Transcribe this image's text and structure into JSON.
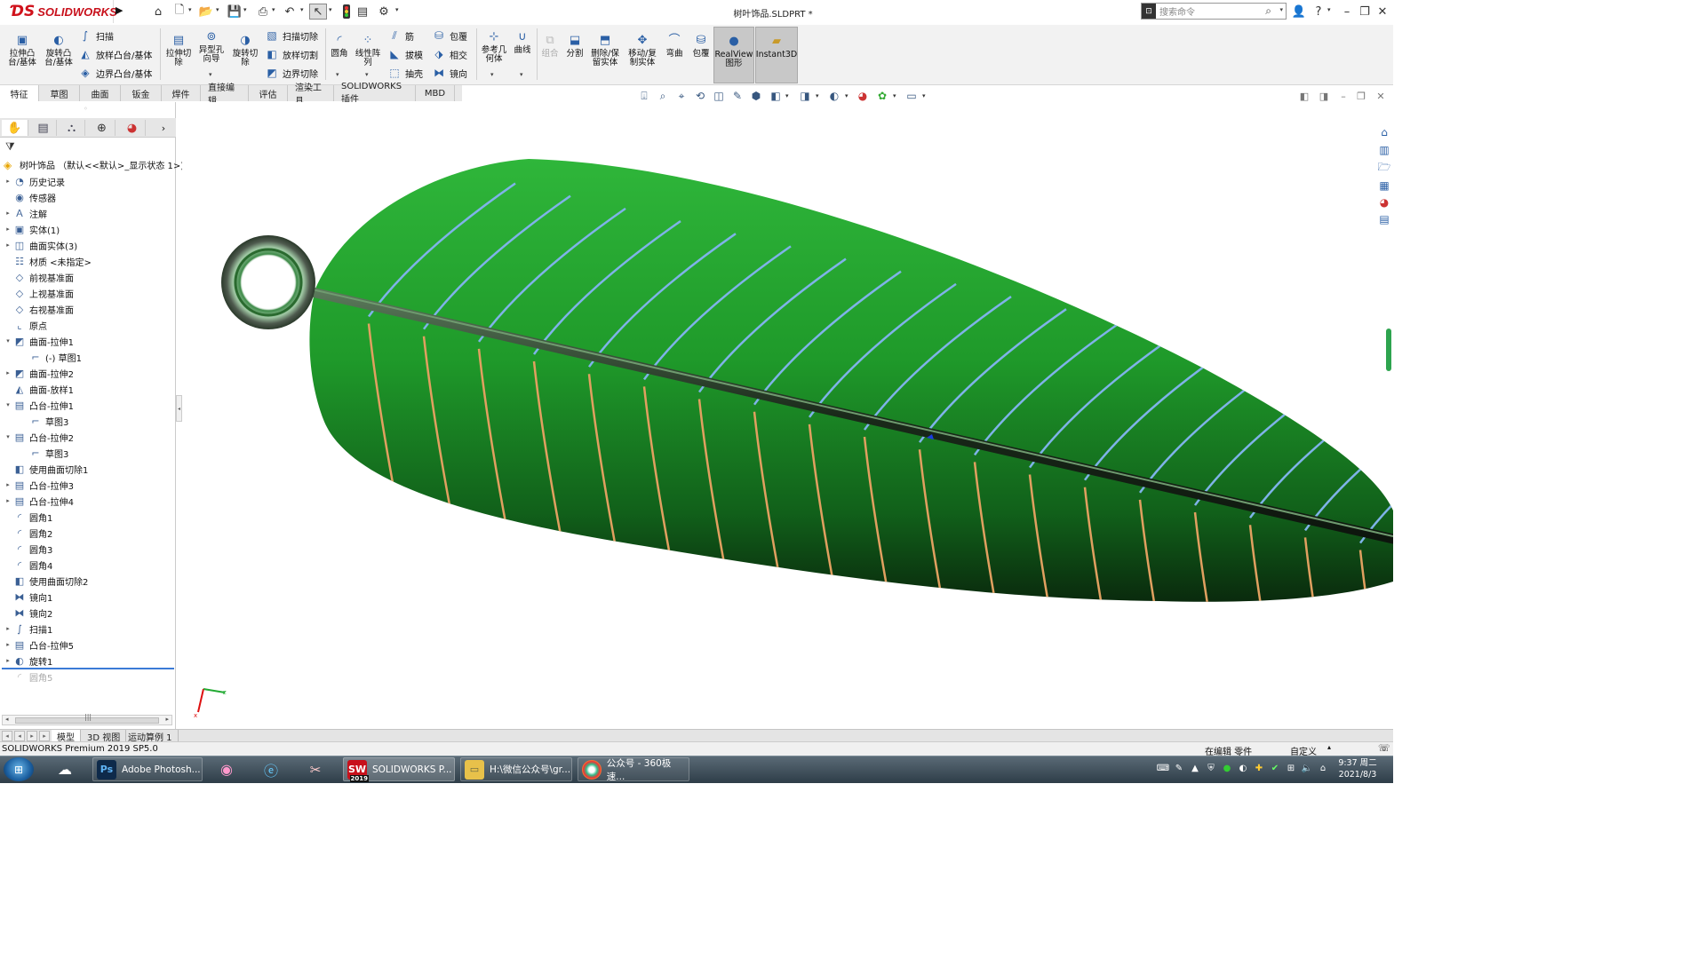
{
  "app": {
    "brand": "SOLIDWORKS",
    "doc_title": "树叶饰品.SLDPRT *"
  },
  "search": {
    "placeholder": "搜索命令"
  },
  "ribbon": {
    "big": {
      "extrude_boss": "拉伸凸\n台/基体",
      "revolve_boss": "旋转凸\n台/基体",
      "extrude_cut": "拉伸切\n除",
      "hole_wizard": "异型孔\n向导",
      "revolve_cut": "旋转切\n除",
      "fillet": "圆角",
      "linear_pattern": "线性阵\n列",
      "ref_geometry": "参考几\n何体",
      "curves": "曲线",
      "combine": "组合",
      "split": "分割",
      "delete_keep": "删除/保\n留实体",
      "move_copy": "移动/复\n制实体",
      "flex": "弯曲",
      "wrap2": "包覆",
      "realview": "RealView\n图形",
      "instant3d": "Instant3D"
    },
    "small": {
      "sweep": "扫描",
      "loft": "放样凸台/基体",
      "boundary": "边界凸台/基体",
      "sweep_cut": "扫描切除",
      "loft_cut": "放样切割",
      "boundary_cut": "边界切除",
      "rib": "筋",
      "draft": "拔模",
      "shell": "抽壳",
      "wrap": "包覆",
      "intersect": "相交",
      "mirror": "镜向"
    }
  },
  "tabs": [
    "特征",
    "草图",
    "曲面",
    "钣金",
    "焊件",
    "直接编辑",
    "评估",
    "渲染工具",
    "SOLIDWORKS 插件",
    "MBD"
  ],
  "tree": {
    "root": "树叶饰品 （默认<<默认>_显示状态 1>)",
    "items": [
      {
        "label": "历史记录",
        "icon": "history-icon",
        "exp": true,
        "indent": 0
      },
      {
        "label": "传感器",
        "icon": "sensor-icon",
        "exp": false,
        "indent": 0
      },
      {
        "label": "注解",
        "icon": "annotation-icon",
        "exp": true,
        "indent": 0
      },
      {
        "label": "实体(1)",
        "icon": "solid-bodies-icon",
        "exp": true,
        "indent": 0
      },
      {
        "label": "曲面实体(3)",
        "icon": "surface-bodies-icon",
        "exp": true,
        "indent": 0
      },
      {
        "label": "材质 <未指定>",
        "icon": "material-icon",
        "exp": false,
        "indent": 0
      },
      {
        "label": "前视基准面",
        "icon": "plane-icon",
        "exp": false,
        "indent": 0
      },
      {
        "label": "上视基准面",
        "icon": "plane-icon",
        "exp": false,
        "indent": 0
      },
      {
        "label": "右视基准面",
        "icon": "plane-icon",
        "exp": false,
        "indent": 0
      },
      {
        "label": "原点",
        "icon": "origin-icon",
        "exp": false,
        "indent": 0
      },
      {
        "label": "曲面-拉伸1",
        "icon": "surface-extrude-icon",
        "exp": "open",
        "indent": 0
      },
      {
        "label": "(-) 草图1",
        "icon": "sketch-icon",
        "exp": false,
        "indent": 1
      },
      {
        "label": "曲面-拉伸2",
        "icon": "surface-extrude-icon",
        "exp": true,
        "indent": 0
      },
      {
        "label": "曲面-放样1",
        "icon": "surface-loft-icon",
        "exp": false,
        "indent": 0
      },
      {
        "label": "凸台-拉伸1",
        "icon": "boss-extrude-icon",
        "exp": "open",
        "indent": 0
      },
      {
        "label": "草图3",
        "icon": "sketch-icon",
        "exp": false,
        "indent": 1
      },
      {
        "label": "凸台-拉伸2",
        "icon": "boss-extrude-icon",
        "exp": "open",
        "indent": 0
      },
      {
        "label": "草图3",
        "icon": "sketch-icon",
        "exp": false,
        "indent": 1
      },
      {
        "label": "使用曲面切除1",
        "icon": "surface-cut-icon",
        "exp": false,
        "indent": 0
      },
      {
        "label": "凸台-拉伸3",
        "icon": "boss-extrude-icon",
        "exp": true,
        "indent": 0
      },
      {
        "label": "凸台-拉伸4",
        "icon": "boss-extrude-icon",
        "exp": true,
        "indent": 0
      },
      {
        "label": "圆角1",
        "icon": "fillet-icon",
        "exp": false,
        "indent": 0
      },
      {
        "label": "圆角2",
        "icon": "fillet-icon",
        "exp": false,
        "indent": 0
      },
      {
        "label": "圆角3",
        "icon": "fillet-icon",
        "exp": false,
        "indent": 0
      },
      {
        "label": "圆角4",
        "icon": "fillet-icon",
        "exp": false,
        "indent": 0
      },
      {
        "label": "使用曲面切除2",
        "icon": "surface-cut-icon",
        "exp": false,
        "indent": 0
      },
      {
        "label": "镜向1",
        "icon": "mirror-icon",
        "exp": false,
        "indent": 0
      },
      {
        "label": "镜向2",
        "icon": "mirror-icon",
        "exp": false,
        "indent": 0
      },
      {
        "label": "扫描1",
        "icon": "sweep-icon",
        "exp": true,
        "indent": 0
      },
      {
        "label": "凸台-拉伸5",
        "icon": "boss-extrude-icon",
        "exp": true,
        "indent": 0
      },
      {
        "label": "旋转1",
        "icon": "revolve-icon",
        "exp": true,
        "indent": 0
      },
      {
        "label": "圆角5",
        "icon": "fillet-icon",
        "exp": false,
        "indent": 0,
        "faded": true
      }
    ]
  },
  "bottom_tabs": [
    "模型",
    "3D 视图",
    "运动算例 1"
  ],
  "status": {
    "product": "SOLIDWORKS Premium 2019 SP5.0",
    "mode": "在编辑 零件",
    "custom": "自定义"
  },
  "taskbar": {
    "photoshop": "Adobe Photosh...",
    "solidworks": "SOLIDWORKS P...",
    "explorer": "H:\\微信公众号\\gr...",
    "browser": "公众号 - 360极速...",
    "sw_badge": "2019"
  },
  "clock": {
    "time": "9:37 周二",
    "date": "2021/8/3"
  },
  "colors": {
    "leaf_green": "#1f9a2a",
    "brand_red": "#c8101b",
    "rollback_bar": "#3b7bd6"
  }
}
